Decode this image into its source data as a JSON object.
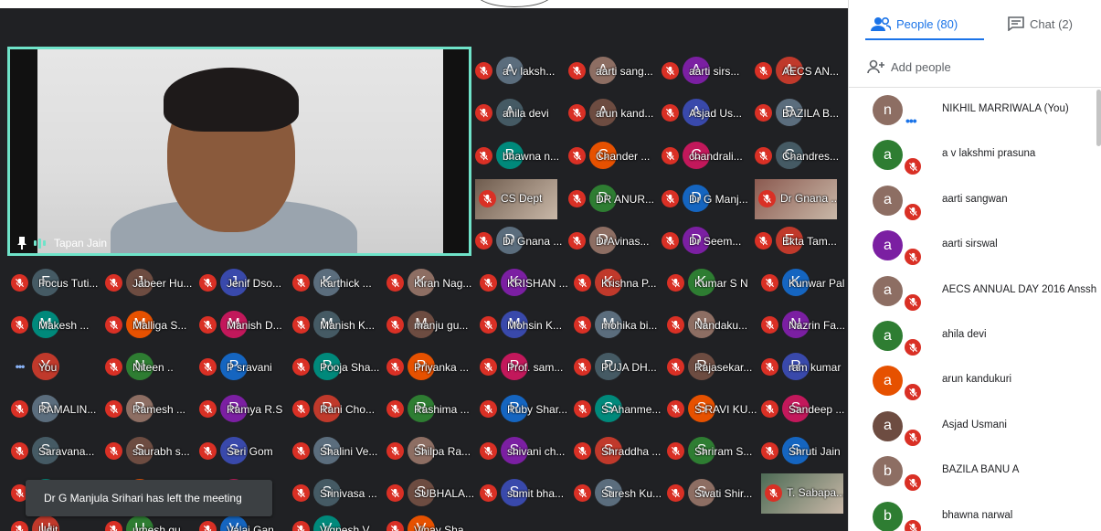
{
  "colors": {
    "accent": "#1a73e8",
    "mute_red": "#d93025",
    "speaker_border": "#6fe3c9",
    "grid_bg": "#202124"
  },
  "main_tile": {
    "name": "Tapan Jain"
  },
  "grid_rows": [
    [
      "a v laksh...",
      "aarti sang...",
      "aarti sirs...",
      "AECS AN..."
    ],
    [
      "ahila devi",
      "arun kand...",
      "Asjad Us...",
      "BAZILA B..."
    ],
    [
      "bhawna n...",
      "Chander ...",
      "chandrali...",
      "Chandres..."
    ],
    [
      "CS Dept",
      "DR ANUR...",
      "Dr G Manj...",
      "Dr Gnana ..."
    ],
    [
      "Dr Gnana ...",
      "DrAvinas...",
      "Dr Seem...",
      "Ekta Tam..."
    ],
    [
      "Focus Tuti...",
      "Jabeer Hu...",
      "Jenif Dso...",
      "Karthick ...",
      "Kiran Nag...",
      "KRISHAN ...",
      "Krishna P...",
      "Kumar S N",
      "Kunwar Pal"
    ],
    [
      "Makesh ...",
      "Malliga S...",
      "Manish D...",
      "Manish K...",
      "manju gu...",
      "Mohsin K...",
      "mohika bi...",
      "Nandaku...",
      "Nazrin Fa..."
    ],
    [
      "You",
      "Niteen ..",
      "P sravani",
      "Pooja Sha...",
      "Priyanka ...",
      "Prof. sam...",
      "PUJA DH...",
      "Rajasekar...",
      "ram kumar"
    ],
    [
      "RAMALIN...",
      "Ramesh ...",
      "Ramya R.S",
      "Rani Cho...",
      "Rashima ...",
      "Ruby Shar...",
      "S Ahanme...",
      "S RAVI KU...",
      "Sandeep ..."
    ],
    [
      "Saravana...",
      "saurabh s...",
      "Seri Gom",
      "Shalini Ve...",
      "Shilpa Ra...",
      "shivani ch...",
      "Shraddha ...",
      "Shriram S...",
      "Shruti Jain"
    ],
    [
      "",
      "",
      "...ir...",
      "Srinivasa ...",
      "SUBHALA...",
      "sumit bha...",
      "Suresh Ku...",
      "Swati Shir...",
      "T. Sabapa..."
    ],
    [
      "Udit",
      "umesh gu...",
      "Valai Gan...",
      "Vignesh V",
      "Vinay Sha..."
    ]
  ],
  "toast": {
    "message": "Dr G Manjula Srihari has left the meeting"
  },
  "sidebar": {
    "tab_people": "People (80)",
    "tab_chat": "Chat (2)",
    "add_people": "Add people",
    "people": [
      "NIKHIL MARRIWALA (You)",
      "a v lakshmi prasuna",
      "aarti sangwan",
      "aarti sirswal",
      "AECS ANNUAL DAY 2016 Anssh",
      "ahila devi",
      "arun kandukuri",
      "Asjad Usmani",
      "BAZILA BANU A",
      "bhawna narwal"
    ]
  }
}
